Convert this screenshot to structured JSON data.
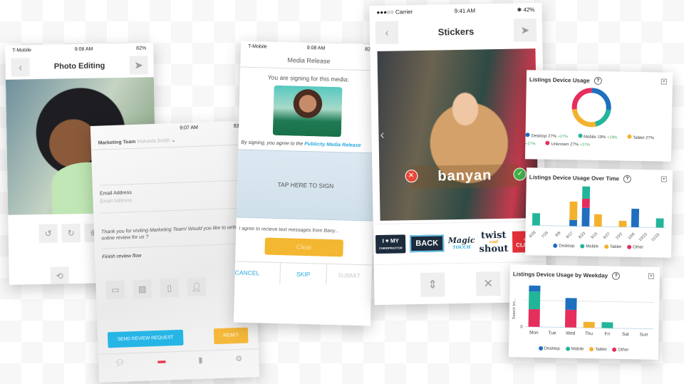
{
  "colors": {
    "desktop": "#1f6fbf",
    "mobile": "#22b59a",
    "tablet": "#f3b22e",
    "other": "#e62e5c",
    "accent_blue": "#27a9e1",
    "accent_yellow": "#f4b731"
  },
  "photo_editing": {
    "status": {
      "carrier": "T-Mobile",
      "time": "9:08 AM",
      "battery": "82%"
    },
    "title": "Photo Editing",
    "back_icon": "chevron-left-icon",
    "send_icon": "paper-plane-icon",
    "tools_row1": [
      "rotate-left-icon",
      "rotate-right-icon",
      "zoom-in-icon",
      "zoom-out-icon"
    ],
    "tools_row2": [
      "reset-icon",
      "cancel-edit-icon"
    ]
  },
  "review": {
    "status": {
      "time": "9:07 AM",
      "battery": "83%"
    },
    "account": "Marketing Team",
    "user": "Makaela Smith",
    "email_label": "Email Address",
    "email_placeholder": "Email Address",
    "message": "Thank you for visiting Marketing Team! Would you like to write an online review for us ?",
    "finish_flow": "Finish review flow",
    "send_button": "SEND REVIEW REQUEST",
    "reset_button": "RESET"
  },
  "media_release": {
    "status": {
      "carrier": "T-Mobile",
      "time": "9:08 AM",
      "battery": "82"
    },
    "title": "Media Release",
    "subtitle": "You are signing for this media:",
    "agree_prefix": "By signing, you agree to the",
    "agree_link": "Publicity Media Release",
    "sign_prompt": "TAP HERE TO SIGN",
    "sms_consent": "I agree to recieve text messages from Bany...",
    "clear_button": "Clear",
    "cancel_button": "CANCEL",
    "skip_button": "SKIP",
    "submit_button": "SUBMIT"
  },
  "stickers": {
    "status": {
      "carrier": "Carrier",
      "time": "9:41 AM",
      "battery": "42%"
    },
    "title": "Stickers",
    "overlay_text": "banyan",
    "sticker_items": [
      {
        "line1": "I ♥ MY",
        "line2": "CHIROPRACTOR"
      },
      {
        "line1": "BACK",
        "line2": ""
      },
      {
        "line1": "Magic",
        "line2": "TOUCH"
      },
      {
        "line1": "twist",
        "mid": "and",
        "line2": "shout"
      },
      {
        "line1": "Love",
        "line2": "CLIENTS"
      }
    ]
  },
  "chart_data": [
    {
      "type": "pie",
      "title": "Listings Device Usage",
      "categories": [
        "Desktop",
        "Mobile",
        "Tablet",
        "Unknown"
      ],
      "values": [
        27,
        19,
        27,
        27
      ],
      "changes": [
        "+27%",
        "+19%",
        "+27%",
        "+27%"
      ],
      "legend_labels": [
        "Desktop 27%",
        "Mobile 19%",
        "Tablet 27%",
        "Unknown 27%"
      ]
    },
    {
      "type": "bar",
      "title": "Listings Device Usage Over Time",
      "categories": [
        "6/28",
        "7/26",
        "8/8",
        "8/17",
        "8/23",
        "9/15",
        "9/27",
        "10/2",
        "10/8",
        "10/23",
        "11/23"
      ],
      "series": [
        {
          "name": "Desktop",
          "values": [
            0,
            0,
            0,
            1,
            3,
            0,
            0,
            0,
            3,
            0,
            0
          ]
        },
        {
          "name": "Mobile",
          "values": [
            2,
            0,
            0,
            0,
            2,
            0,
            0,
            0,
            0,
            0,
            1.5
          ]
        },
        {
          "name": "Tablet",
          "values": [
            0,
            0,
            0,
            3,
            0,
            2,
            0,
            1,
            0,
            0,
            0
          ]
        },
        {
          "name": "Other",
          "values": [
            0,
            0,
            0,
            0,
            1.5,
            0,
            0,
            0,
            0,
            0,
            0
          ]
        }
      ],
      "legend": [
        "Desktop",
        "Mobile",
        "Tablet",
        "Other"
      ],
      "legend_position": "bottom"
    },
    {
      "type": "bar",
      "title": "Listings Device Usage by Weekday",
      "ylabel": "Search Im...",
      "categories": [
        "Mon",
        "Tue",
        "Wed",
        "Thu",
        "Fri",
        "Sat",
        "Sun"
      ],
      "series": [
        {
          "name": "Desktop",
          "values": [
            1,
            0,
            2,
            0,
            0,
            0,
            0
          ]
        },
        {
          "name": "Mobile",
          "values": [
            3,
            0,
            0,
            0,
            1,
            0,
            0
          ]
        },
        {
          "name": "Tablet",
          "values": [
            0,
            0,
            0,
            1,
            0,
            0,
            0
          ]
        },
        {
          "name": "Other",
          "values": [
            3,
            0,
            3,
            0,
            0,
            0,
            0
          ]
        }
      ],
      "ytick_zero": "0",
      "legend": [
        "Desktop",
        "Mobile",
        "Tablet",
        "Other"
      ],
      "legend_position": "bottom"
    }
  ]
}
